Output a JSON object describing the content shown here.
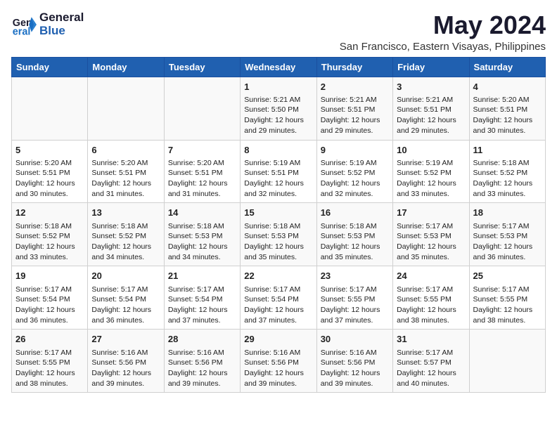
{
  "logo": {
    "line1": "General",
    "line2": "Blue"
  },
  "title": "May 2024",
  "subtitle": "San Francisco, Eastern Visayas, Philippines",
  "days_of_week": [
    "Sunday",
    "Monday",
    "Tuesday",
    "Wednesday",
    "Thursday",
    "Friday",
    "Saturday"
  ],
  "weeks": [
    [
      {
        "num": "",
        "info": ""
      },
      {
        "num": "",
        "info": ""
      },
      {
        "num": "",
        "info": ""
      },
      {
        "num": "1",
        "info": "Sunrise: 5:21 AM\nSunset: 5:50 PM\nDaylight: 12 hours and 29 minutes."
      },
      {
        "num": "2",
        "info": "Sunrise: 5:21 AM\nSunset: 5:51 PM\nDaylight: 12 hours and 29 minutes."
      },
      {
        "num": "3",
        "info": "Sunrise: 5:21 AM\nSunset: 5:51 PM\nDaylight: 12 hours and 29 minutes."
      },
      {
        "num": "4",
        "info": "Sunrise: 5:20 AM\nSunset: 5:51 PM\nDaylight: 12 hours and 30 minutes."
      }
    ],
    [
      {
        "num": "5",
        "info": "Sunrise: 5:20 AM\nSunset: 5:51 PM\nDaylight: 12 hours and 30 minutes."
      },
      {
        "num": "6",
        "info": "Sunrise: 5:20 AM\nSunset: 5:51 PM\nDaylight: 12 hours and 31 minutes."
      },
      {
        "num": "7",
        "info": "Sunrise: 5:20 AM\nSunset: 5:51 PM\nDaylight: 12 hours and 31 minutes."
      },
      {
        "num": "8",
        "info": "Sunrise: 5:19 AM\nSunset: 5:51 PM\nDaylight: 12 hours and 32 minutes."
      },
      {
        "num": "9",
        "info": "Sunrise: 5:19 AM\nSunset: 5:52 PM\nDaylight: 12 hours and 32 minutes."
      },
      {
        "num": "10",
        "info": "Sunrise: 5:19 AM\nSunset: 5:52 PM\nDaylight: 12 hours and 33 minutes."
      },
      {
        "num": "11",
        "info": "Sunrise: 5:18 AM\nSunset: 5:52 PM\nDaylight: 12 hours and 33 minutes."
      }
    ],
    [
      {
        "num": "12",
        "info": "Sunrise: 5:18 AM\nSunset: 5:52 PM\nDaylight: 12 hours and 33 minutes."
      },
      {
        "num": "13",
        "info": "Sunrise: 5:18 AM\nSunset: 5:52 PM\nDaylight: 12 hours and 34 minutes."
      },
      {
        "num": "14",
        "info": "Sunrise: 5:18 AM\nSunset: 5:53 PM\nDaylight: 12 hours and 34 minutes."
      },
      {
        "num": "15",
        "info": "Sunrise: 5:18 AM\nSunset: 5:53 PM\nDaylight: 12 hours and 35 minutes."
      },
      {
        "num": "16",
        "info": "Sunrise: 5:18 AM\nSunset: 5:53 PM\nDaylight: 12 hours and 35 minutes."
      },
      {
        "num": "17",
        "info": "Sunrise: 5:17 AM\nSunset: 5:53 PM\nDaylight: 12 hours and 35 minutes."
      },
      {
        "num": "18",
        "info": "Sunrise: 5:17 AM\nSunset: 5:53 PM\nDaylight: 12 hours and 36 minutes."
      }
    ],
    [
      {
        "num": "19",
        "info": "Sunrise: 5:17 AM\nSunset: 5:54 PM\nDaylight: 12 hours and 36 minutes."
      },
      {
        "num": "20",
        "info": "Sunrise: 5:17 AM\nSunset: 5:54 PM\nDaylight: 12 hours and 36 minutes."
      },
      {
        "num": "21",
        "info": "Sunrise: 5:17 AM\nSunset: 5:54 PM\nDaylight: 12 hours and 37 minutes."
      },
      {
        "num": "22",
        "info": "Sunrise: 5:17 AM\nSunset: 5:54 PM\nDaylight: 12 hours and 37 minutes."
      },
      {
        "num": "23",
        "info": "Sunrise: 5:17 AM\nSunset: 5:55 PM\nDaylight: 12 hours and 37 minutes."
      },
      {
        "num": "24",
        "info": "Sunrise: 5:17 AM\nSunset: 5:55 PM\nDaylight: 12 hours and 38 minutes."
      },
      {
        "num": "25",
        "info": "Sunrise: 5:17 AM\nSunset: 5:55 PM\nDaylight: 12 hours and 38 minutes."
      }
    ],
    [
      {
        "num": "26",
        "info": "Sunrise: 5:17 AM\nSunset: 5:55 PM\nDaylight: 12 hours and 38 minutes."
      },
      {
        "num": "27",
        "info": "Sunrise: 5:16 AM\nSunset: 5:56 PM\nDaylight: 12 hours and 39 minutes."
      },
      {
        "num": "28",
        "info": "Sunrise: 5:16 AM\nSunset: 5:56 PM\nDaylight: 12 hours and 39 minutes."
      },
      {
        "num": "29",
        "info": "Sunrise: 5:16 AM\nSunset: 5:56 PM\nDaylight: 12 hours and 39 minutes."
      },
      {
        "num": "30",
        "info": "Sunrise: 5:16 AM\nSunset: 5:56 PM\nDaylight: 12 hours and 39 minutes."
      },
      {
        "num": "31",
        "info": "Sunrise: 5:17 AM\nSunset: 5:57 PM\nDaylight: 12 hours and 40 minutes."
      },
      {
        "num": "",
        "info": ""
      }
    ]
  ]
}
